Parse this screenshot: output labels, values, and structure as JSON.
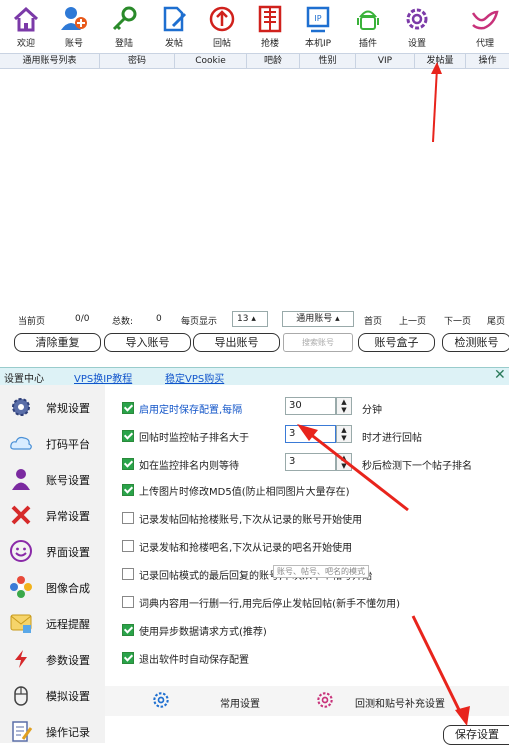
{
  "toolbar": [
    {
      "label": "欢迎",
      "icon": "home-icon"
    },
    {
      "label": "账号",
      "icon": "add-user-icon"
    },
    {
      "label": "登陆",
      "icon": "key-icon"
    },
    {
      "label": "发帖",
      "icon": "edit-document-icon"
    },
    {
      "label": "回帖",
      "icon": "upload-arrow-icon"
    },
    {
      "label": "抢楼",
      "icon": "building-icon"
    },
    {
      "label": "本机IP",
      "icon": "ip-icon"
    },
    {
      "label": "插件",
      "icon": "android-icon"
    },
    {
      "label": "设置",
      "icon": "gear-icon"
    },
    {
      "label": "代理",
      "icon": "bird-icon"
    }
  ],
  "table_headers": [
    "通用账号列表",
    "密码",
    "Cookie",
    "吧龄",
    "性别",
    "VIP",
    "发帖量",
    "操作"
  ],
  "pager": {
    "current_label": "当前页",
    "current_value": "0/0",
    "total_label": "总数:",
    "total_value": "0",
    "per_page_label": "每页显示",
    "per_page_value": "13",
    "account_type": "通用账号",
    "first": "首页",
    "prev": "上一页",
    "next": "下一页",
    "last": "尾页"
  },
  "buttons": {
    "clear_dup": "清除重复",
    "import": "导入账号",
    "export": "导出账号",
    "search_placeholder": "搜索账号",
    "account_box": "账号盒子",
    "check": "检测账号"
  },
  "settings_header": {
    "title": "设置中心",
    "link1": "VPS换IP教程",
    "link2": "稳定VPS购买"
  },
  "sidebar": [
    {
      "label": "常规设置",
      "icon": "gear-icon"
    },
    {
      "label": "打码平台",
      "icon": "cloud-icon"
    },
    {
      "label": "账号设置",
      "icon": "user-icon"
    },
    {
      "label": "异常设置",
      "icon": "cross-icon"
    },
    {
      "label": "界面设置",
      "icon": "smiley-icon"
    },
    {
      "label": "图像合成",
      "icon": "flower-icon"
    },
    {
      "label": "远程提醒",
      "icon": "message-icon"
    },
    {
      "label": "参数设置",
      "icon": "pointer-icon"
    },
    {
      "label": "模拟设置",
      "icon": "mouse-icon"
    },
    {
      "label": "操作记录",
      "icon": "notepad-icon"
    }
  ],
  "options": [
    {
      "text": "启用定时保存配置,每隔",
      "checked": true,
      "value": "30",
      "suffix": "分钟",
      "style": "blue"
    },
    {
      "text": "回帖时监控帖子排名大于",
      "checked": true,
      "value": "3",
      "suffix": "时才进行回帖",
      "style": "normal"
    },
    {
      "text": "如在监控排名内则等待",
      "checked": true,
      "value": "3",
      "suffix": "秒后检测下一个帖子排名",
      "style": "normal"
    },
    {
      "text": "上传图片时修改MD5值(防止相同图片大量存在)",
      "checked": true,
      "style": "normal"
    },
    {
      "text": "记录发帖回帖抢楼账号,下次从记录的账号开始使用",
      "checked": false,
      "style": "normal"
    },
    {
      "text": "记录发帖和抢楼吧名,下次从记录的吧名开始使用",
      "checked": false,
      "style": "normal"
    },
    {
      "text": "记录回帖模式的最后回复的账号,下次从下个帖号开始",
      "checked": false,
      "style": "normal"
    },
    {
      "text": "词典内容用一行删一行,用完后停止发帖回帖(新手不懂勿用)",
      "checked": false,
      "style": "normal"
    },
    {
      "text": "使用异步数据请求方式(推荐)",
      "checked": true,
      "style": "normal"
    },
    {
      "text": "退出软件时自动保存配置",
      "checked": true,
      "style": "normal"
    }
  ],
  "tooltip": "账号、帖号、吧名的模式",
  "bottom_tabs": {
    "general": "常用设置",
    "other": "回测和贴号补充设置"
  },
  "save_button": "保存设置",
  "colors": {
    "accent": "#2aa34a",
    "link": "#1155cc",
    "arrow": "#e8241c"
  }
}
